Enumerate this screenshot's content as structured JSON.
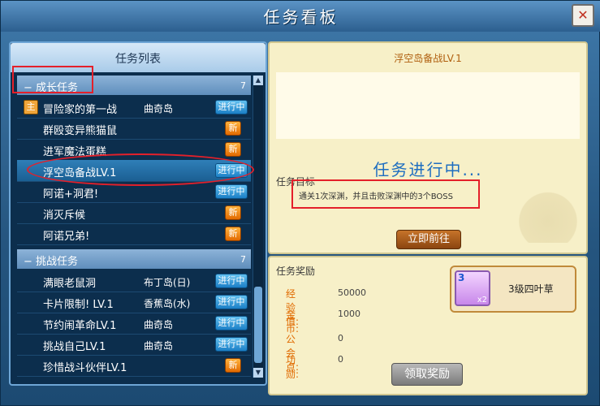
{
  "window": {
    "title": "任务看板",
    "close_symbol": "✕"
  },
  "list": {
    "header": "任务列表",
    "categories": [
      {
        "toggle": "−",
        "label": "成长任务",
        "count": "7"
      },
      {
        "toggle": "−",
        "label": "挑战任务",
        "count": "7"
      }
    ],
    "growth_quests": [
      {
        "icon": "主",
        "name": "冒险家的第一战",
        "map": "曲奇岛",
        "status": "进行中"
      },
      {
        "name": "群殴变异熊猫鼠",
        "map": "",
        "status": "新"
      },
      {
        "name": "进军魔法蛋糕",
        "map": "",
        "status": "新"
      },
      {
        "name": "浮空岛备战LV.1",
        "map": "",
        "status": "进行中"
      },
      {
        "name": "阿诺+洞君!",
        "map": "",
        "status": "进行中"
      },
      {
        "name": "消灭斥候",
        "map": "",
        "status": "新"
      },
      {
        "name": "阿诺兄弟!",
        "map": "",
        "status": "新"
      }
    ],
    "challenge_quests": [
      {
        "name": "满眼老鼠洞",
        "map": "布丁岛(日)",
        "status": "进行中"
      },
      {
        "name": "卡片限制! LV.1",
        "map": "香蕉岛(水)",
        "status": "进行中"
      },
      {
        "name": "节约闹革命LV.1",
        "map": "曲奇岛",
        "status": "进行中"
      },
      {
        "name": "挑战自己LV.1",
        "map": "曲奇岛",
        "status": "进行中"
      },
      {
        "name": "珍惜战斗伙伴LV.1",
        "map": "",
        "status": "新"
      }
    ],
    "scroll_up": "▲",
    "scroll_down": "▼"
  },
  "detail": {
    "quest_name": "浮空岛备战LV.1",
    "state": "任务进行中...",
    "goal_label": "任务目标",
    "goal_text": "通关1次深渊，并且击败深渊中的3个BOSS",
    "goto_button": "立即前往"
  },
  "rewards": {
    "label": "任务奖励",
    "rows": [
      {
        "key": "经验值:",
        "value": "50000"
      },
      {
        "key": "金　币:",
        "value": "1000"
      },
      {
        "key": "公会点:",
        "value": "0"
      },
      {
        "key": "功　勋:",
        "value": "0"
      }
    ],
    "item": {
      "level": "3",
      "count": "x2",
      "name": "3级四叶草"
    },
    "claim_button": "领取奖励"
  },
  "colors": {
    "highlight": "#e4202a",
    "in_progress_text": "#1e6ec0",
    "badge_ing": "#1b7fc6",
    "badge_new": "#e26a00"
  }
}
